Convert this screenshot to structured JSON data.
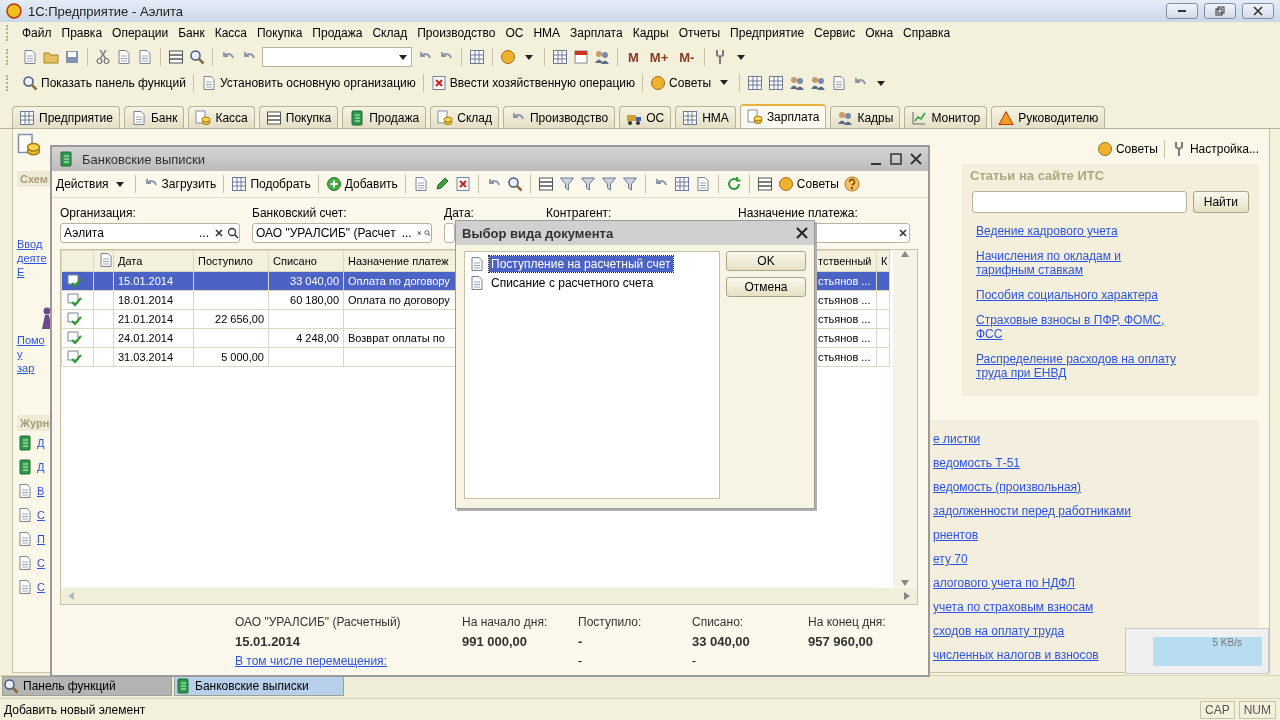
{
  "window": {
    "title": "1С:Предприятие - Аэлита"
  },
  "menu": [
    "Файл",
    "Правка",
    "Операции",
    "Банк",
    "Касса",
    "Покупка",
    "Продажа",
    "Склад",
    "Производство",
    "ОС",
    "НМА",
    "Зарплата",
    "Кадры",
    "Отчеты",
    "Предприятие",
    "Сервис",
    "Окна",
    "Справка"
  ],
  "toolbar": {
    "memory_buttons": [
      "M",
      "M+",
      "M-"
    ]
  },
  "function_toolbar": [
    "Показать панель функций",
    "Установить основную организацию",
    "Ввести хозяйственную операцию",
    "Советы"
  ],
  "tabs": [
    {
      "label": "Предприятие",
      "selected": false
    },
    {
      "label": "Банк",
      "selected": false
    },
    {
      "label": "Касса",
      "selected": false
    },
    {
      "label": "Покупка",
      "selected": false
    },
    {
      "label": "Продажа",
      "selected": false
    },
    {
      "label": "Склад",
      "selected": false
    },
    {
      "label": "Производство",
      "selected": false
    },
    {
      "label": "ОС",
      "selected": false
    },
    {
      "label": "НМА",
      "selected": false
    },
    {
      "label": "Зарплата",
      "selected": true
    },
    {
      "label": "Кадры",
      "selected": false
    },
    {
      "label": "Монитор",
      "selected": false
    },
    {
      "label": "Руководителю",
      "selected": false
    }
  ],
  "left_panel": {
    "section_1": "Схем",
    "link_1": [
      "Ввод",
      "деяте",
      "Е"
    ],
    "link_2": [
      "Помо",
      "у",
      "зар"
    ],
    "section_2": "Журн",
    "links": [
      "Д",
      "Д",
      "В",
      "С",
      "П",
      "С",
      "С"
    ]
  },
  "header_links": [
    "Советы",
    "Настройка..."
  ],
  "its_panel": {
    "title": "Статьи на сайте ИТС",
    "search_button": "Найти",
    "links": [
      "Ведение кадрового учета",
      "Начисления по окладам и тарифным ставкам",
      "Пособия социального характера",
      "Страховые взносы в ПФР, ФОМС, ФСС",
      "Распределение расходов на оплату труда при ЕНВД"
    ]
  },
  "journal_links": [
    "е листки",
    "ведомость Т-51",
    "ведомость (произвольная)",
    "задолженности перед работниками",
    "рнентов",
    "ету 70",
    "алогового учета по НДФЛ",
    "учета по страховым взносам",
    "сходов на оплату труда",
    "численных налогов и взносов"
  ],
  "bank_window": {
    "title": "Банковские выписки",
    "toolbar": {
      "actions": "Действия",
      "load": "Загрузить",
      "select": "Подобрать",
      "add": "Добавить",
      "tips": "Советы"
    },
    "filters": [
      {
        "label": "Организация:",
        "value": "Аэлита",
        "select_button": "..."
      },
      {
        "label": "Банковский счет:",
        "value": "ОАО \"УРАЛСИБ\" (Расчет",
        "select_button": "..."
      },
      {
        "label": "Дата:"
      },
      {
        "label": "Контрагент:"
      },
      {
        "label": "Назначение платежа:"
      }
    ],
    "table": {
      "columns": [
        "Дата",
        "Поступило",
        "Списано",
        "Назначение платеж",
        "тственный",
        "К"
      ],
      "rows": [
        {
          "date": "15.01.2014",
          "outgoing": "33 040,00",
          "purpose": "Оплата по договору",
          "responsible": "стьянов ...",
          "selected": true
        },
        {
          "date": "18.01.2014",
          "outgoing": "60 180,00",
          "purpose": "Оплата по договору",
          "responsible": "стьянов ...",
          "selected": false
        },
        {
          "date": "21.01.2014",
          "incoming": "22 656,00",
          "responsible": "стьянов ...",
          "selected": false
        },
        {
          "date": "24.01.2014",
          "outgoing": "4 248,00",
          "purpose": "Возврат оплаты по",
          "responsible": "стьянов ...",
          "selected": false
        },
        {
          "date": "31.03.2014",
          "incoming": "5 000,00",
          "responsible": "стьянов ...",
          "selected": false
        }
      ]
    },
    "summary": {
      "account": "ОАО \"УРАЛСИБ\" (Расчетный)",
      "date": "15.01.2014",
      "transfers_link": "В том числе перемещения:",
      "figures": [
        {
          "label": "На начало дня:",
          "value": "991 000,00"
        },
        {
          "label": "Поступило:",
          "value": "-",
          "transfers": "-"
        },
        {
          "label": "Списано:",
          "value": "33 040,00",
          "transfers": "-"
        },
        {
          "label": "На конец дня:",
          "value": "957 960,00"
        }
      ]
    }
  },
  "dialog": {
    "title": "Выбор вида документа",
    "items": [
      {
        "label": "Поступление на расчетный счет",
        "selected": true
      },
      {
        "label": "Списание с расчетного счета",
        "selected": false
      }
    ],
    "buttons": [
      "OK",
      "Отмена"
    ]
  },
  "taskbar": [
    {
      "label": "Панель функций",
      "selected": false
    },
    {
      "label": "Банковские выписки",
      "selected": true
    }
  ],
  "tray": {
    "speed": "5 KB/s"
  },
  "status_bar": {
    "hint": "Добавить новый элемент",
    "indicators": [
      "CAP",
      "NUM"
    ]
  }
}
